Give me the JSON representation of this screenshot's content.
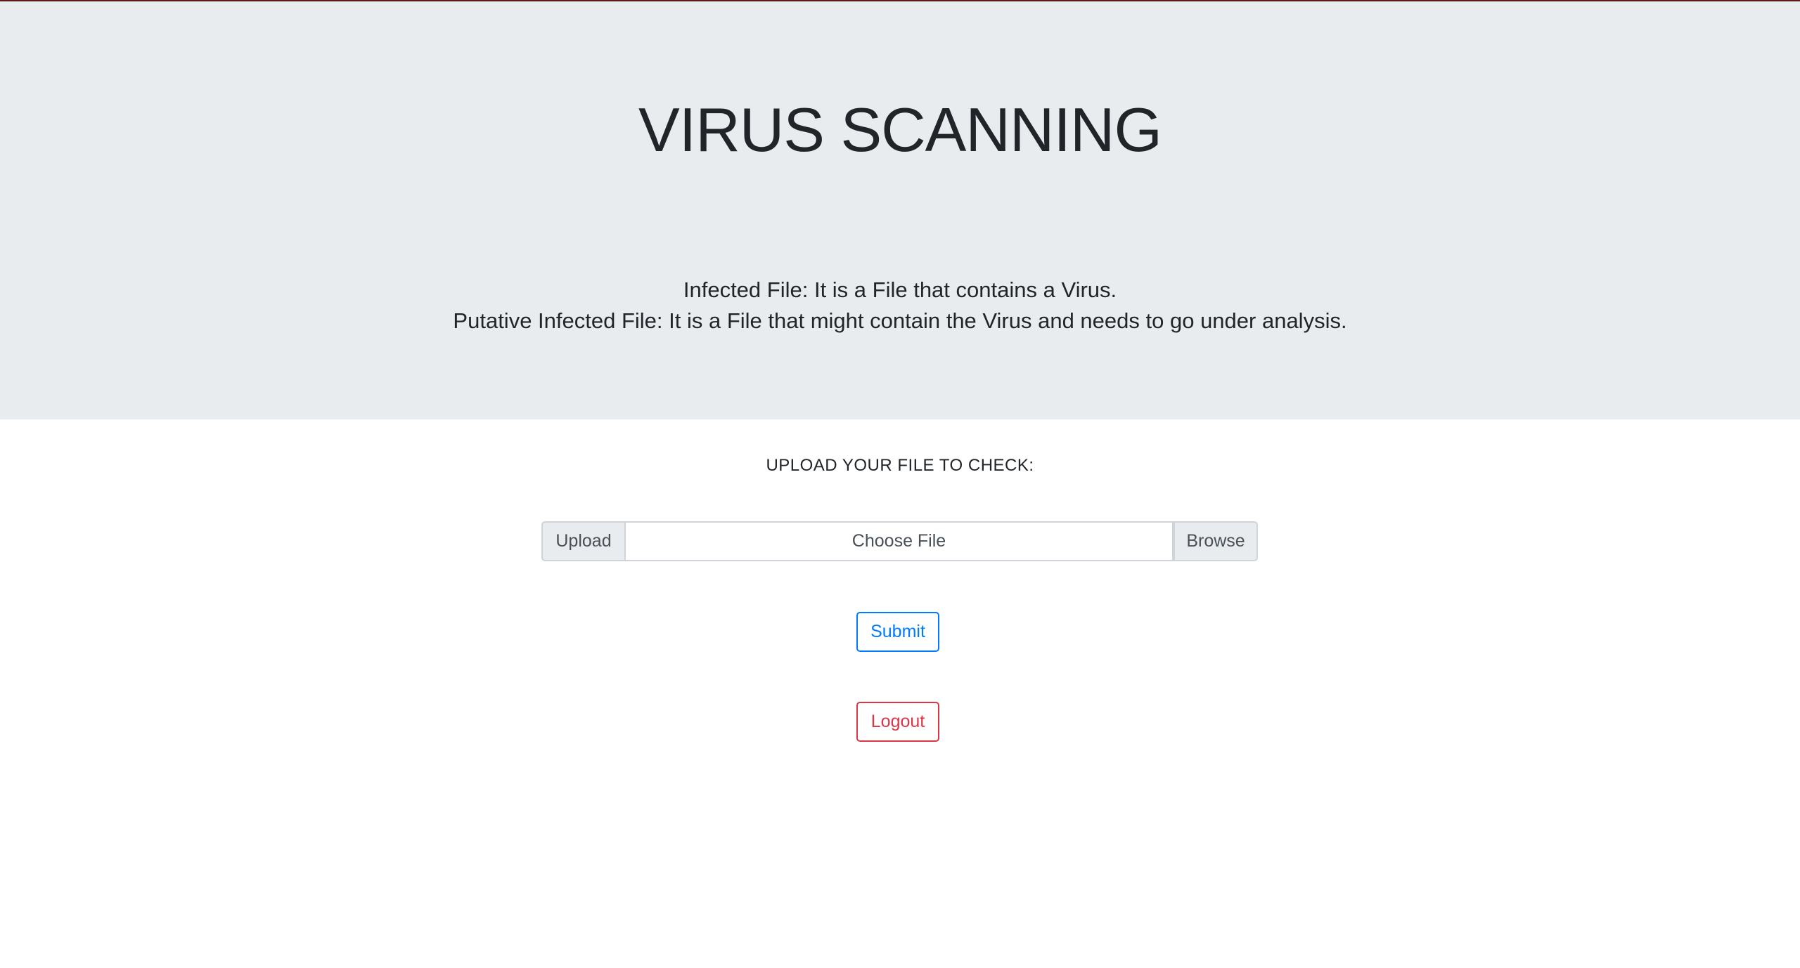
{
  "header": {
    "title": "VIRUS SCANNING",
    "definitions": [
      "Infected File: It is a File that contains a Virus.",
      "Putative Infected File: It is a File that might contain the Virus and needs to go under analysis."
    ]
  },
  "upload": {
    "heading": "UPLOAD YOUR FILE TO CHECK:",
    "prepend_label": "Upload",
    "file_placeholder": "Choose File",
    "browse_label": "Browse"
  },
  "actions": {
    "submit_label": "Submit",
    "logout_label": "Logout"
  },
  "colors": {
    "jumbotron_bg": "#e9ecef",
    "primary": "#007bff",
    "danger": "#dc3545"
  }
}
